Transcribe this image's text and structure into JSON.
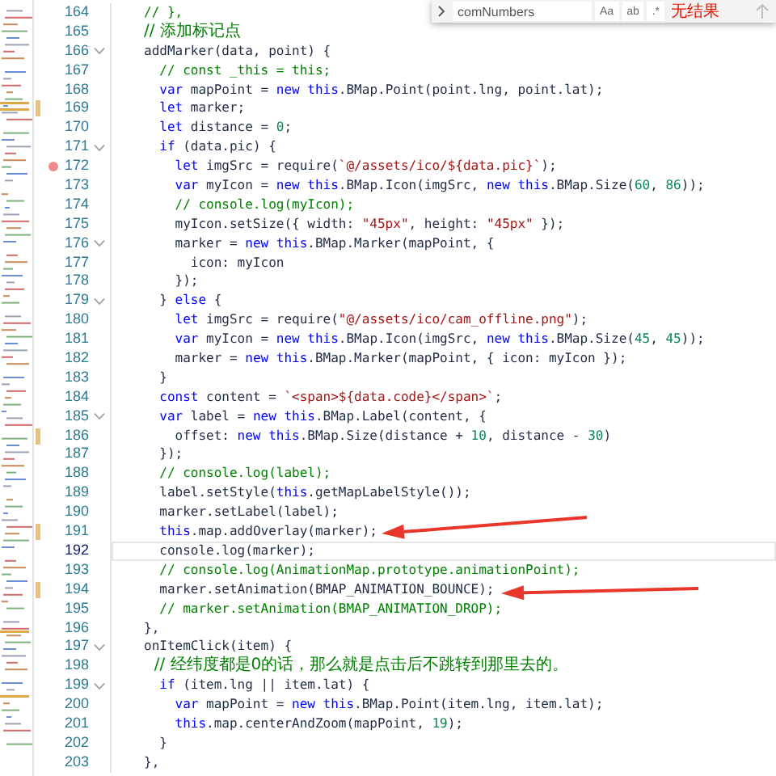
{
  "find_widget": {
    "value": "comNumbers",
    "toggles": [
      {
        "label": "Aa",
        "selected": false
      },
      {
        "label": "ab",
        "selected": false
      },
      {
        "label": ".*",
        "selected": false
      }
    ],
    "result": "无结果"
  },
  "lines": [
    {
      "number": "164",
      "foldable": false,
      "breakpoint": false,
      "changed": false,
      "current": false,
      "segs": [
        {
          "kind": "c",
          "text": "// },"
        }
      ]
    },
    {
      "number": "165",
      "foldable": false,
      "breakpoint": false,
      "changed": false,
      "current": false,
      "segs": [
        {
          "kind": "cj",
          "text": "// 添加标记点"
        }
      ]
    },
    {
      "number": "166",
      "foldable": true,
      "breakpoint": false,
      "changed": false,
      "current": false,
      "segs": [
        {
          "kind": "p",
          "text": "addMarker(data, point) {"
        }
      ]
    },
    {
      "number": "167",
      "foldable": false,
      "breakpoint": false,
      "changed": false,
      "current": false,
      "segs": [
        {
          "kind": "c",
          "text": "  // const _this = this;"
        }
      ]
    },
    {
      "number": "168",
      "foldable": false,
      "breakpoint": false,
      "changed": false,
      "current": false,
      "segs": [
        {
          "kind": "k",
          "text": "  var "
        },
        {
          "kind": "p",
          "text": "mapPoint = "
        },
        {
          "kind": "k",
          "text": "new this"
        },
        {
          "kind": "p",
          "text": ".BMap.Point(point.lng, point.lat);"
        }
      ]
    },
    {
      "number": "169",
      "foldable": false,
      "breakpoint": false,
      "changed": true,
      "current": false,
      "segs": [
        {
          "kind": "k",
          "text": "  let "
        },
        {
          "kind": "p",
          "text": "marker;"
        }
      ]
    },
    {
      "number": "170",
      "foldable": false,
      "breakpoint": false,
      "changed": false,
      "current": false,
      "segs": [
        {
          "kind": "k",
          "text": "  let "
        },
        {
          "kind": "p",
          "text": "distance = "
        },
        {
          "kind": "n",
          "text": "0"
        },
        {
          "kind": "p",
          "text": ";"
        }
      ]
    },
    {
      "number": "171",
      "foldable": true,
      "breakpoint": false,
      "changed": false,
      "current": false,
      "segs": [
        {
          "kind": "k",
          "text": "  if "
        },
        {
          "kind": "p",
          "text": "(data.pic) {"
        }
      ]
    },
    {
      "number": "172",
      "foldable": false,
      "breakpoint": true,
      "changed": false,
      "current": false,
      "segs": [
        {
          "kind": "k",
          "text": "    let "
        },
        {
          "kind": "p",
          "text": "imgSrc = require("
        },
        {
          "kind": "s",
          "text": "`@/assets/ico/${data.pic}`"
        },
        {
          "kind": "p",
          "text": ");"
        }
      ]
    },
    {
      "number": "173",
      "foldable": false,
      "breakpoint": false,
      "changed": false,
      "current": false,
      "segs": [
        {
          "kind": "k",
          "text": "    var "
        },
        {
          "kind": "p",
          "text": "myIcon = "
        },
        {
          "kind": "k",
          "text": "new this"
        },
        {
          "kind": "p",
          "text": ".BMap.Icon(imgSrc, "
        },
        {
          "kind": "k",
          "text": "new this"
        },
        {
          "kind": "p",
          "text": ".BMap.Size("
        },
        {
          "kind": "n",
          "text": "60"
        },
        {
          "kind": "p",
          "text": ", "
        },
        {
          "kind": "n",
          "text": "86"
        },
        {
          "kind": "p",
          "text": "));"
        }
      ]
    },
    {
      "number": "174",
      "foldable": false,
      "breakpoint": false,
      "changed": false,
      "current": false,
      "segs": [
        {
          "kind": "c",
          "text": "    // console.log(myIcon);"
        }
      ]
    },
    {
      "number": "175",
      "foldable": false,
      "breakpoint": false,
      "changed": false,
      "current": false,
      "segs": [
        {
          "kind": "p",
          "text": "    myIcon.setSize({ width: "
        },
        {
          "kind": "s",
          "text": "\"45px\""
        },
        {
          "kind": "p",
          "text": ", height: "
        },
        {
          "kind": "s",
          "text": "\"45px\""
        },
        {
          "kind": "p",
          "text": " });"
        }
      ]
    },
    {
      "number": "176",
      "foldable": true,
      "breakpoint": false,
      "changed": false,
      "current": false,
      "segs": [
        {
          "kind": "p",
          "text": "    marker = "
        },
        {
          "kind": "k",
          "text": "new this"
        },
        {
          "kind": "p",
          "text": ".BMap.Marker(mapPoint, {"
        }
      ]
    },
    {
      "number": "177",
      "foldable": false,
      "breakpoint": false,
      "changed": false,
      "current": false,
      "segs": [
        {
          "kind": "p",
          "text": "      icon: myIcon"
        }
      ]
    },
    {
      "number": "178",
      "foldable": false,
      "breakpoint": false,
      "changed": false,
      "current": false,
      "segs": [
        {
          "kind": "p",
          "text": "    });"
        }
      ]
    },
    {
      "number": "179",
      "foldable": true,
      "breakpoint": false,
      "changed": false,
      "current": false,
      "segs": [
        {
          "kind": "p",
          "text": "  } "
        },
        {
          "kind": "k",
          "text": "else"
        },
        {
          "kind": "p",
          "text": " {"
        }
      ]
    },
    {
      "number": "180",
      "foldable": false,
      "breakpoint": false,
      "changed": false,
      "current": false,
      "segs": [
        {
          "kind": "k",
          "text": "    let "
        },
        {
          "kind": "p",
          "text": "imgSrc = require("
        },
        {
          "kind": "s",
          "text": "\"@/assets/ico/cam_offline.png\""
        },
        {
          "kind": "p",
          "text": ");"
        }
      ]
    },
    {
      "number": "181",
      "foldable": false,
      "breakpoint": false,
      "changed": false,
      "current": false,
      "segs": [
        {
          "kind": "k",
          "text": "    var "
        },
        {
          "kind": "p",
          "text": "myIcon = "
        },
        {
          "kind": "k",
          "text": "new this"
        },
        {
          "kind": "p",
          "text": ".BMap.Icon(imgSrc, "
        },
        {
          "kind": "k",
          "text": "new this"
        },
        {
          "kind": "p",
          "text": ".BMap.Size("
        },
        {
          "kind": "n",
          "text": "45"
        },
        {
          "kind": "p",
          "text": ", "
        },
        {
          "kind": "n",
          "text": "45"
        },
        {
          "kind": "p",
          "text": "));"
        }
      ]
    },
    {
      "number": "182",
      "foldable": false,
      "breakpoint": false,
      "changed": false,
      "current": false,
      "segs": [
        {
          "kind": "p",
          "text": "    marker = "
        },
        {
          "kind": "k",
          "text": "new this"
        },
        {
          "kind": "p",
          "text": ".BMap.Marker(mapPoint, { icon: myIcon });"
        }
      ]
    },
    {
      "number": "183",
      "foldable": false,
      "breakpoint": false,
      "changed": false,
      "current": false,
      "segs": [
        {
          "kind": "p",
          "text": "  }"
        }
      ]
    },
    {
      "number": "184",
      "foldable": false,
      "breakpoint": false,
      "changed": false,
      "current": false,
      "segs": [
        {
          "kind": "k",
          "text": "  const "
        },
        {
          "kind": "p",
          "text": "content = "
        },
        {
          "kind": "s",
          "text": "`<span>${data.code}</span>`"
        },
        {
          "kind": "p",
          "text": ";"
        }
      ]
    },
    {
      "number": "185",
      "foldable": true,
      "breakpoint": false,
      "changed": false,
      "current": false,
      "segs": [
        {
          "kind": "k",
          "text": "  var "
        },
        {
          "kind": "p",
          "text": "label = "
        },
        {
          "kind": "k",
          "text": "new this"
        },
        {
          "kind": "p",
          "text": ".BMap.Label(content, {"
        }
      ]
    },
    {
      "number": "186",
      "foldable": false,
      "breakpoint": false,
      "changed": true,
      "current": false,
      "segs": [
        {
          "kind": "p",
          "text": "    offset: "
        },
        {
          "kind": "k",
          "text": "new this"
        },
        {
          "kind": "p",
          "text": ".BMap.Size(distance + "
        },
        {
          "kind": "n",
          "text": "10"
        },
        {
          "kind": "p",
          "text": ", distance - "
        },
        {
          "kind": "n",
          "text": "30"
        },
        {
          "kind": "p",
          "text": ")"
        }
      ]
    },
    {
      "number": "187",
      "foldable": false,
      "breakpoint": false,
      "changed": false,
      "current": false,
      "segs": [
        {
          "kind": "p",
          "text": "  });"
        }
      ]
    },
    {
      "number": "188",
      "foldable": false,
      "breakpoint": false,
      "changed": false,
      "current": false,
      "segs": [
        {
          "kind": "c",
          "text": "  // console.log(label);"
        }
      ]
    },
    {
      "number": "189",
      "foldable": false,
      "breakpoint": false,
      "changed": false,
      "current": false,
      "segs": [
        {
          "kind": "p",
          "text": "  label.setStyle("
        },
        {
          "kind": "k",
          "text": "this"
        },
        {
          "kind": "p",
          "text": ".getMapLabelStyle());"
        }
      ]
    },
    {
      "number": "190",
      "foldable": false,
      "breakpoint": false,
      "changed": false,
      "current": false,
      "segs": [
        {
          "kind": "p",
          "text": "  marker.setLabel(label);"
        }
      ]
    },
    {
      "number": "191",
      "foldable": false,
      "breakpoint": false,
      "changed": true,
      "current": false,
      "segs": [
        {
          "kind": "k",
          "text": "  this"
        },
        {
          "kind": "p",
          "text": ".map.addOverlay(marker);"
        }
      ]
    },
    {
      "number": "192",
      "foldable": false,
      "breakpoint": false,
      "changed": false,
      "current": true,
      "segs": [
        {
          "kind": "p",
          "text": "  console.log(marker);"
        }
      ]
    },
    {
      "number": "193",
      "foldable": false,
      "breakpoint": false,
      "changed": false,
      "current": false,
      "segs": [
        {
          "kind": "c",
          "text": "  // console.log(AnimationMap.prototype.animationPoint);"
        }
      ]
    },
    {
      "number": "194",
      "foldable": false,
      "breakpoint": false,
      "changed": true,
      "current": false,
      "segs": [
        {
          "kind": "p",
          "text": "  marker.setAnimation(BMAP_ANIMATION_BOUNCE);"
        }
      ]
    },
    {
      "number": "195",
      "foldable": false,
      "breakpoint": false,
      "changed": false,
      "current": false,
      "segs": [
        {
          "kind": "c",
          "text": "  // marker.setAnimation(BMAP_ANIMATION_DROP);"
        }
      ]
    },
    {
      "number": "196",
      "foldable": false,
      "breakpoint": false,
      "changed": false,
      "current": false,
      "segs": [
        {
          "kind": "p",
          "text": "},"
        }
      ]
    },
    {
      "number": "197",
      "foldable": true,
      "breakpoint": false,
      "changed": false,
      "current": false,
      "segs": [
        {
          "kind": "p",
          "text": "onItemClick(item) {"
        }
      ]
    },
    {
      "number": "198",
      "foldable": false,
      "breakpoint": false,
      "changed": false,
      "current": false,
      "segs": [
        {
          "kind": "cj",
          "text": "  // 经纬度都是0的话，那么就是点击后不跳转到那里去的。"
        }
      ]
    },
    {
      "number": "199",
      "foldable": true,
      "breakpoint": false,
      "changed": false,
      "current": false,
      "segs": [
        {
          "kind": "k",
          "text": "  if "
        },
        {
          "kind": "p",
          "text": "(item.lng || item.lat) {"
        }
      ]
    },
    {
      "number": "200",
      "foldable": false,
      "breakpoint": false,
      "changed": false,
      "current": false,
      "segs": [
        {
          "kind": "k",
          "text": "    var "
        },
        {
          "kind": "p",
          "text": "mapPoint = "
        },
        {
          "kind": "k",
          "text": "new this"
        },
        {
          "kind": "p",
          "text": ".BMap.Point(item.lng, item.lat);"
        }
      ]
    },
    {
      "number": "201",
      "foldable": false,
      "breakpoint": false,
      "changed": false,
      "current": false,
      "segs": [
        {
          "kind": "k",
          "text": "    this"
        },
        {
          "kind": "p",
          "text": ".map.centerAndZoom(mapPoint, "
        },
        {
          "kind": "n",
          "text": "19"
        },
        {
          "kind": "p",
          "text": ");"
        }
      ]
    },
    {
      "number": "202",
      "foldable": false,
      "breakpoint": false,
      "changed": false,
      "current": false,
      "segs": [
        {
          "kind": "p",
          "text": "  }"
        }
      ]
    },
    {
      "number": "203",
      "foldable": false,
      "breakpoint": false,
      "changed": false,
      "current": false,
      "segs": [
        {
          "kind": "p",
          "text": "},"
        }
      ]
    }
  ]
}
